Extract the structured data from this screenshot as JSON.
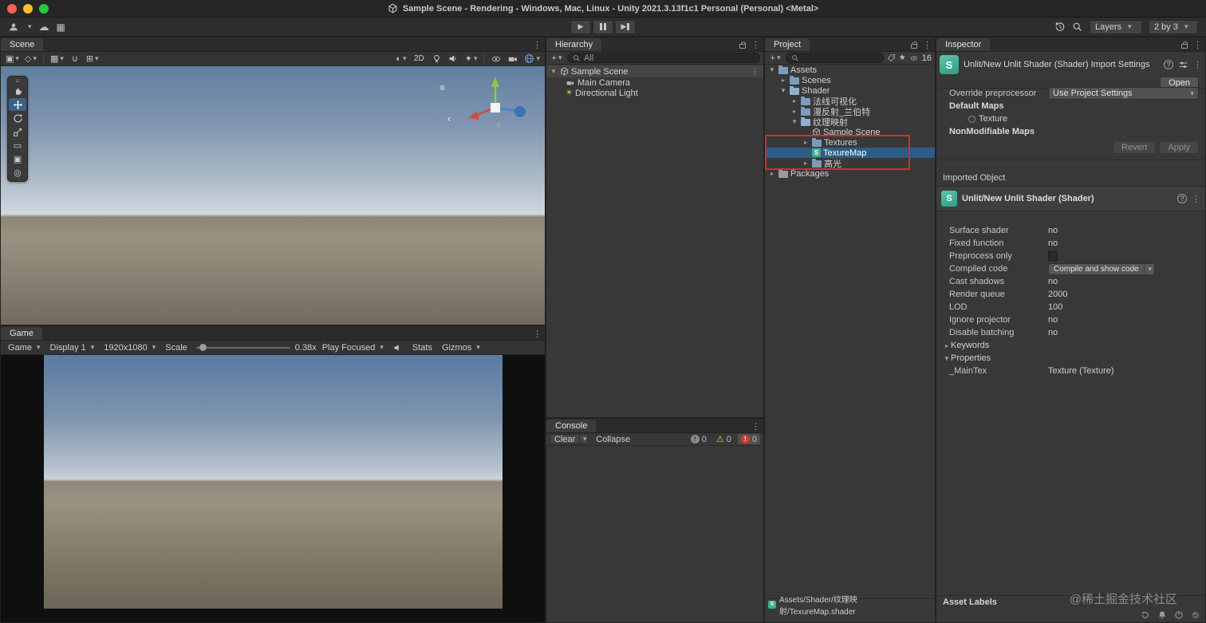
{
  "titlebar": {
    "title": "Sample Scene - Rendering - Windows, Mac, Linux - Unity 2021.3.13f1c1 Personal (Personal) <Metal>"
  },
  "topbar": {
    "layers": "Layers",
    "layout": "2 by 3"
  },
  "scene_panel": {
    "tab": "Scene",
    "mode_2d": "2D"
  },
  "game_panel": {
    "tab": "Game",
    "menu": "Game",
    "display": "Display 1",
    "resolution": "1920x1080",
    "scale_label": "Scale",
    "scale_value": "0.38x",
    "focus_mode": "Play Focused",
    "stats": "Stats",
    "gizmos": "Gizmos"
  },
  "hierarchy": {
    "tab": "Hierarchy",
    "search_scope": "All",
    "root": {
      "label": "Sample Scene",
      "tri": "▼"
    },
    "children": [
      {
        "label": "Main Camera"
      },
      {
        "label": "Directional Light"
      }
    ]
  },
  "console": {
    "tab": "Console",
    "clear": "Clear",
    "collapse": "Collapse",
    "counts": {
      "info": "0",
      "warning": "0",
      "error": "0"
    }
  },
  "project": {
    "tab": "Project",
    "hidden_count": "16",
    "tree": [
      {
        "label": "Assets",
        "tri": "▼"
      },
      {
        "label": "Scenes",
        "tri": "▸"
      },
      {
        "label": "Shader",
        "tri": "▼"
      },
      {
        "label": "法线可视化",
        "tri": "▸"
      },
      {
        "label": "漫反射_兰伯特",
        "tri": "▸"
      },
      {
        "label": "纹理映射",
        "tri": "▼"
      },
      {
        "label": "Sample Scene",
        "tri": ""
      },
      {
        "label": "Textures",
        "tri": "▸"
      },
      {
        "label": "TexureMap",
        "tri": ""
      },
      {
        "label": "高光",
        "tri": "▸"
      },
      {
        "label": "Packages",
        "tri": "▸"
      }
    ],
    "status_path": "Assets/Shader/纹理映射/TexureMap.shader"
  },
  "inspector": {
    "tab": "Inspector",
    "header_title": "Unlit/New Unlit Shader (Shader) Import Settings",
    "open_button": "Open",
    "override_label": "Override preprocessor",
    "override_value": "Use Project Settings",
    "default_maps_label": "Default Maps",
    "texture_label": "Texture",
    "nonmodifiable_label": "NonModifiable Maps",
    "revert_button": "Revert",
    "apply_button": "Apply",
    "imported_object_label": "Imported Object",
    "object_title": "Unlit/New Unlit Shader (Shader)",
    "props": [
      {
        "label": "Surface shader",
        "value": "no"
      },
      {
        "label": "Fixed function",
        "value": "no"
      },
      {
        "label": "Preprocess only",
        "value": ""
      },
      {
        "label": "Compiled code",
        "value": "Compile and show code"
      },
      {
        "label": "Cast shadows",
        "value": "no"
      },
      {
        "label": "Render queue",
        "value": "2000"
      },
      {
        "label": "LOD",
        "value": "100"
      },
      {
        "label": "Ignore projector",
        "value": "no"
      },
      {
        "label": "Disable batching",
        "value": "no"
      }
    ],
    "keywords_label": "Keywords",
    "properties_label": "Properties",
    "maintex_label": "_MainTex",
    "maintex_value": "Texture (Texture)",
    "asset_labels": "Asset Labels"
  },
  "watermark": "@稀土掘金技术社区",
  "icons": {
    "dots": "⋮",
    "caret": "▾",
    "plus": "+",
    "play": "▶",
    "cloud": "☁",
    "grid": "▦",
    "pivot": "▣",
    "axis": "◇",
    "magnet": "∪",
    "snap": "⊞",
    "shading": "◐",
    "sparkle": "✦",
    "rect_tool": "▭",
    "transform_tool": "▣",
    "more_tool": "◎",
    "hamburger": "≡",
    "chevron_left": "‹",
    "sun": "☀",
    "star": "★",
    "exclaim": "!",
    "warning": "⚠",
    "help": "?",
    "shader_letter": "S"
  }
}
